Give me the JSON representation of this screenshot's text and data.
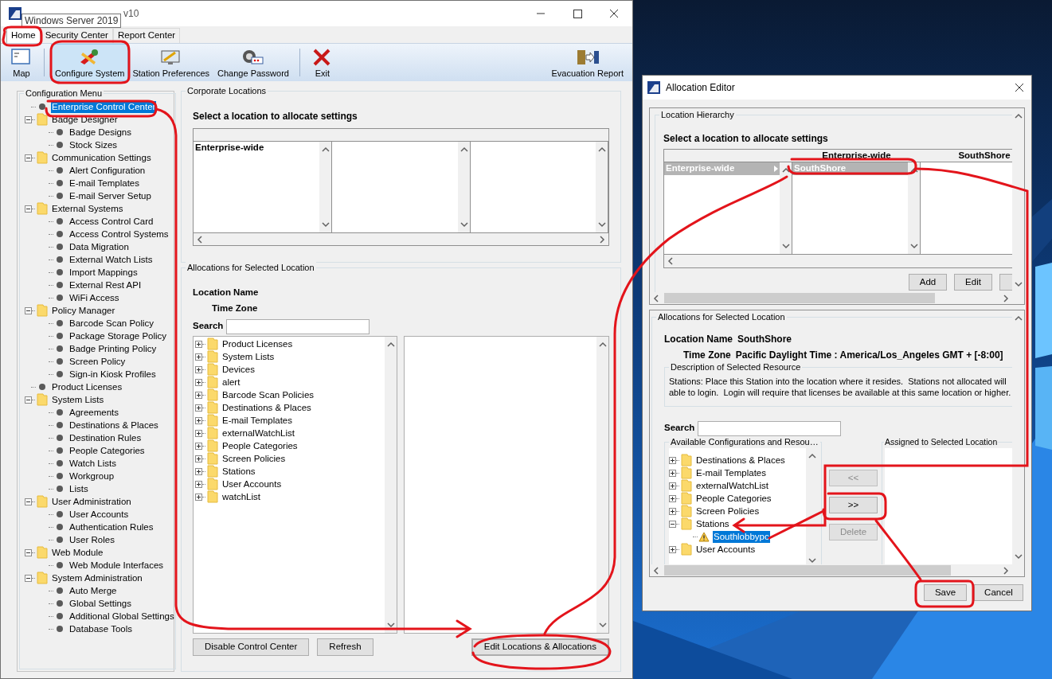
{
  "main_window": {
    "title": "v10",
    "tooltip": "Windows Server 2019",
    "tabs": [
      {
        "label": "Home",
        "selected": true
      },
      {
        "label": "Security Center",
        "selected": false
      },
      {
        "label": "Report Center",
        "selected": false
      }
    ],
    "toolbar": [
      {
        "kind": "map",
        "label": "Map",
        "selected": false
      },
      {
        "kind": "configure",
        "label": "Configure System",
        "selected": true
      },
      {
        "kind": "preferences",
        "label": "Station Preferences",
        "selected": false
      },
      {
        "kind": "password",
        "label": "Change Password",
        "selected": false
      },
      {
        "kind": "exit",
        "label": "Exit",
        "selected": false
      },
      {
        "kind": "evacuation",
        "label": "Evacuation Report",
        "selected": false
      }
    ],
    "config_menu": {
      "title": "Configuration Menu",
      "items": [
        {
          "kind": "leaf",
          "label": "Enterprise Control Center",
          "selected": true
        },
        {
          "kind": "folder",
          "label": "Badge Designer",
          "selected": false,
          "expanded": true,
          "children": [
            {
              "kind": "leaf",
              "label": "Badge Designs",
              "selected": false
            },
            {
              "kind": "leaf",
              "label": "Stock Sizes",
              "selected": false
            }
          ]
        },
        {
          "kind": "folder",
          "label": "Communication Settings",
          "selected": false,
          "expanded": true,
          "children": [
            {
              "kind": "leaf",
              "label": "Alert Configuration",
              "selected": false
            },
            {
              "kind": "leaf",
              "label": "E-mail Templates",
              "selected": false
            },
            {
              "kind": "leaf",
              "label": "E-mail Server Setup",
              "selected": false
            }
          ]
        },
        {
          "kind": "folder",
          "label": "External Systems",
          "selected": false,
          "expanded": true,
          "children": [
            {
              "kind": "leaf",
              "label": "Access Control Card",
              "selected": false
            },
            {
              "kind": "leaf",
              "label": "Access Control Systems",
              "selected": false
            },
            {
              "kind": "leaf",
              "label": "Data Migration",
              "selected": false
            },
            {
              "kind": "leaf",
              "label": "External Watch Lists",
              "selected": false
            },
            {
              "kind": "leaf",
              "label": "Import Mappings",
              "selected": false
            },
            {
              "kind": "leaf",
              "label": "External Rest API",
              "selected": false
            },
            {
              "kind": "leaf",
              "label": "WiFi Access",
              "selected": false
            }
          ]
        },
        {
          "kind": "folder",
          "label": "Policy Manager",
          "selected": false,
          "expanded": true,
          "children": [
            {
              "kind": "leaf",
              "label": "Barcode Scan Policy",
              "selected": false
            },
            {
              "kind": "leaf",
              "label": "Package Storage Policy",
              "selected": false
            },
            {
              "kind": "leaf",
              "label": "Badge Printing Policy",
              "selected": false
            },
            {
              "kind": "leaf",
              "label": "Screen Policy",
              "selected": false
            },
            {
              "kind": "leaf",
              "label": "Sign-in Kiosk Profiles",
              "selected": false
            }
          ]
        },
        {
          "kind": "leaf",
          "label": "Product Licenses",
          "selected": false
        },
        {
          "kind": "folder",
          "label": "System Lists",
          "selected": false,
          "expanded": true,
          "children": [
            {
              "kind": "leaf",
              "label": "Agreements",
              "selected": false
            },
            {
              "kind": "leaf",
              "label": "Destinations & Places",
              "selected": false
            },
            {
              "kind": "leaf",
              "label": "Destination Rules",
              "selected": false
            },
            {
              "kind": "leaf",
              "label": "People Categories",
              "selected": false
            },
            {
              "kind": "leaf",
              "label": "Watch Lists",
              "selected": false
            },
            {
              "kind": "leaf",
              "label": "Workgroup",
              "selected": false
            },
            {
              "kind": "leaf",
              "label": "Lists",
              "selected": false
            }
          ]
        },
        {
          "kind": "folder",
          "label": "User Administration",
          "selected": false,
          "expanded": true,
          "children": [
            {
              "kind": "leaf",
              "label": "User Accounts",
              "selected": false
            },
            {
              "kind": "leaf",
              "label": "Authentication Rules",
              "selected": false
            },
            {
              "kind": "leaf",
              "label": "User Roles",
              "selected": false
            }
          ]
        },
        {
          "kind": "folder",
          "label": "Web Module",
          "selected": false,
          "expanded": true,
          "children": [
            {
              "kind": "leaf",
              "label": "Web Module Interfaces",
              "selected": false
            }
          ]
        },
        {
          "kind": "folder",
          "label": "System Administration",
          "selected": false,
          "expanded": true,
          "children": [
            {
              "kind": "leaf",
              "label": "Auto Merge",
              "selected": false
            },
            {
              "kind": "leaf",
              "label": "Global Settings",
              "selected": false
            },
            {
              "kind": "leaf",
              "label": "Additional Global Settings",
              "selected": false
            },
            {
              "kind": "leaf",
              "label": "Database Tools",
              "selected": false
            }
          ]
        }
      ]
    },
    "corporate_locations": {
      "title": "Corporate Locations",
      "prompt": "Select a location to allocate settings",
      "columns": [
        {
          "items": [
            {
              "label": "Enterprise-wide",
              "selected": false,
              "expandable": false
            }
          ]
        }
      ]
    },
    "allocations": {
      "title": "Allocations for Selected Location",
      "location_name_label": "Location Name",
      "time_zone_label": "Time Zone",
      "search_label": "Search",
      "tree": [
        {
          "kind": "folder",
          "label": "Product Licenses",
          "selected": false,
          "expanded": false
        },
        {
          "kind": "folder",
          "label": "System Lists",
          "selected": false,
          "expanded": false
        },
        {
          "kind": "folder",
          "label": "Devices",
          "selected": false,
          "expanded": false
        },
        {
          "kind": "folder",
          "label": "alert",
          "selected": false,
          "expanded": false
        },
        {
          "kind": "folder",
          "label": "Barcode Scan Policies",
          "selected": false,
          "expanded": false
        },
        {
          "kind": "folder",
          "label": "Destinations & Places",
          "selected": false,
          "expanded": false
        },
        {
          "kind": "folder",
          "label": "E-mail Templates",
          "selected": false,
          "expanded": false
        },
        {
          "kind": "folder",
          "label": "externalWatchList",
          "selected": false,
          "expanded": false
        },
        {
          "kind": "folder",
          "label": "People Categories",
          "selected": false,
          "expanded": false
        },
        {
          "kind": "folder",
          "label": "Screen Policies",
          "selected": false,
          "expanded": false
        },
        {
          "kind": "folder",
          "label": "Stations",
          "selected": false,
          "expanded": false
        },
        {
          "kind": "folder",
          "label": "User Accounts",
          "selected": false,
          "expanded": false
        },
        {
          "kind": "folder",
          "label": "watchList",
          "selected": false,
          "expanded": false
        }
      ],
      "buttons": [
        {
          "label": "Disable Control Center",
          "focused": false
        },
        {
          "label": "Refresh",
          "focused": false
        },
        {
          "label": "Edit Locations & Allocations",
          "focused": true
        }
      ]
    }
  },
  "allocation_editor": {
    "title": "Allocation Editor",
    "hierarchy": {
      "title": "Location Hierarchy",
      "prompt": "Select a location to allocate settings",
      "columns": [
        {
          "items": [
            {
              "label": "Enterprise-wide",
              "selected": true,
              "expandable": true
            }
          ]
        },
        {
          "header": "Enterprise-wide",
          "items": [
            {
              "label": "SouthShore",
              "selected": true,
              "expandable": false
            }
          ]
        },
        {
          "header": "SouthShore"
        }
      ],
      "buttons": [
        "Add",
        "Edit"
      ]
    },
    "allocations": {
      "title": "Allocations for Selected Location",
      "location_name_label": "Location Name",
      "location_name": "SouthShore",
      "time_zone_label": "Time Zone",
      "time_zone": "Pacific Daylight Time : America/Los_Angeles GMT + [-8:00]",
      "description": {
        "title": "Description of Selected Resource",
        "lines": [
          "Stations: Place this Station into the location where it resides.  Stations not allocated will",
          "able to login.  Login will require that licenses be available at this same location or higher."
        ]
      },
      "search_label": "Search",
      "available": {
        "title": "Available Configurations and Resou…",
        "tree": [
          {
            "kind": "folder",
            "label": "Destinations & Places",
            "selected": false,
            "expanded": false
          },
          {
            "kind": "folder",
            "label": "E-mail Templates",
            "selected": false,
            "expanded": false
          },
          {
            "kind": "folder",
            "label": "externalWatchList",
            "selected": false,
            "expanded": false
          },
          {
            "kind": "folder",
            "label": "People Categories",
            "selected": false,
            "expanded": false
          },
          {
            "kind": "folder",
            "label": "Screen Policies",
            "selected": false,
            "expanded": false
          },
          {
            "kind": "folder",
            "label": "Stations",
            "selected": false,
            "expanded": true,
            "children": [
              {
                "kind": "warning",
                "label": "Southlobbypc",
                "selected": true
              }
            ]
          },
          {
            "kind": "folder",
            "label": "User Accounts",
            "selected": false,
            "expanded": false
          }
        ]
      },
      "transfer_buttons": [
        {
          "label": "<<",
          "disabled": true
        },
        {
          "label": ">>",
          "disabled": false
        },
        {
          "label": "Delete",
          "disabled": true
        }
      ],
      "assigned": {
        "title": "Assigned to Selected Location"
      }
    },
    "buttons": [
      "Save",
      "Cancel"
    ]
  }
}
